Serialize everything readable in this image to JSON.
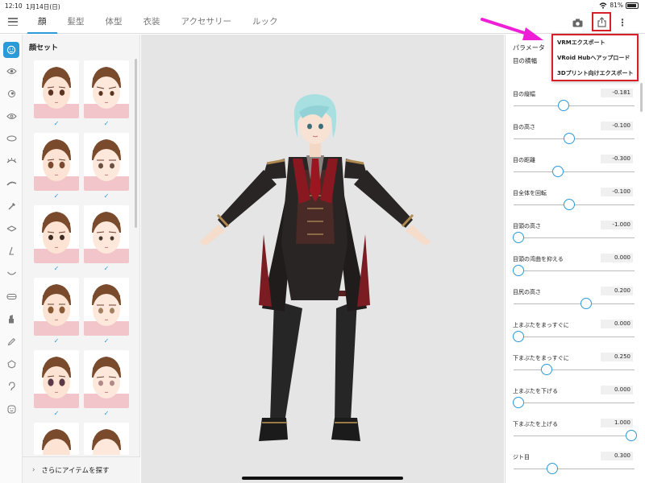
{
  "status": {
    "time": "12:10",
    "date": "1月14日(日)",
    "battery": "81%"
  },
  "tabs": [
    {
      "label": "顔",
      "active": true
    },
    {
      "label": "髪型",
      "active": false
    },
    {
      "label": "体型",
      "active": false
    },
    {
      "label": "衣装",
      "active": false
    },
    {
      "label": "アクセサリー",
      "active": false
    },
    {
      "label": "ルック",
      "active": false
    }
  ],
  "face_panel": {
    "title": "顔セット",
    "more_items_label": "さらにアイテムを探す"
  },
  "params": {
    "title": "パラメータ",
    "first_label": "目の横幅",
    "rows": [
      {
        "label": "目の縦幅",
        "value": "-0.181",
        "level": 0.4
      },
      {
        "label": "目の高さ",
        "value": "-0.100",
        "level": 0.45
      },
      {
        "label": "目の距離",
        "value": "-0.300",
        "level": 0.35
      },
      {
        "label": "目全体を回転",
        "value": "-0.100",
        "level": 0.45
      },
      {
        "label": "目頭の高さ",
        "value": "-1.000",
        "level": 0.0
      },
      {
        "label": "目頭の湾曲を抑える",
        "value": "0.000",
        "level": 0.0
      },
      {
        "label": "目尻の高さ",
        "value": "0.200",
        "level": 0.6
      },
      {
        "label": "上まぶたをまっすぐに",
        "value": "0.000",
        "level": 0.0
      },
      {
        "label": "下まぶたをまっすぐに",
        "value": "0.250",
        "level": 0.25
      },
      {
        "label": "上まぶたを下げる",
        "value": "0.000",
        "level": 0.0
      },
      {
        "label": "下まぶたを上げる",
        "value": "1.000",
        "level": 1.0
      },
      {
        "label": "ジト目",
        "value": "0.300",
        "level": 0.3
      }
    ]
  },
  "export_menu": {
    "items": [
      "VRMエクスポート",
      "VRoid Hubへアップロード",
      "3Dプリント向けエクスポート"
    ]
  },
  "colors": {
    "accent": "#2b9ad8",
    "highlight": "#d61f26",
    "arrow": "#ee1fd6"
  }
}
